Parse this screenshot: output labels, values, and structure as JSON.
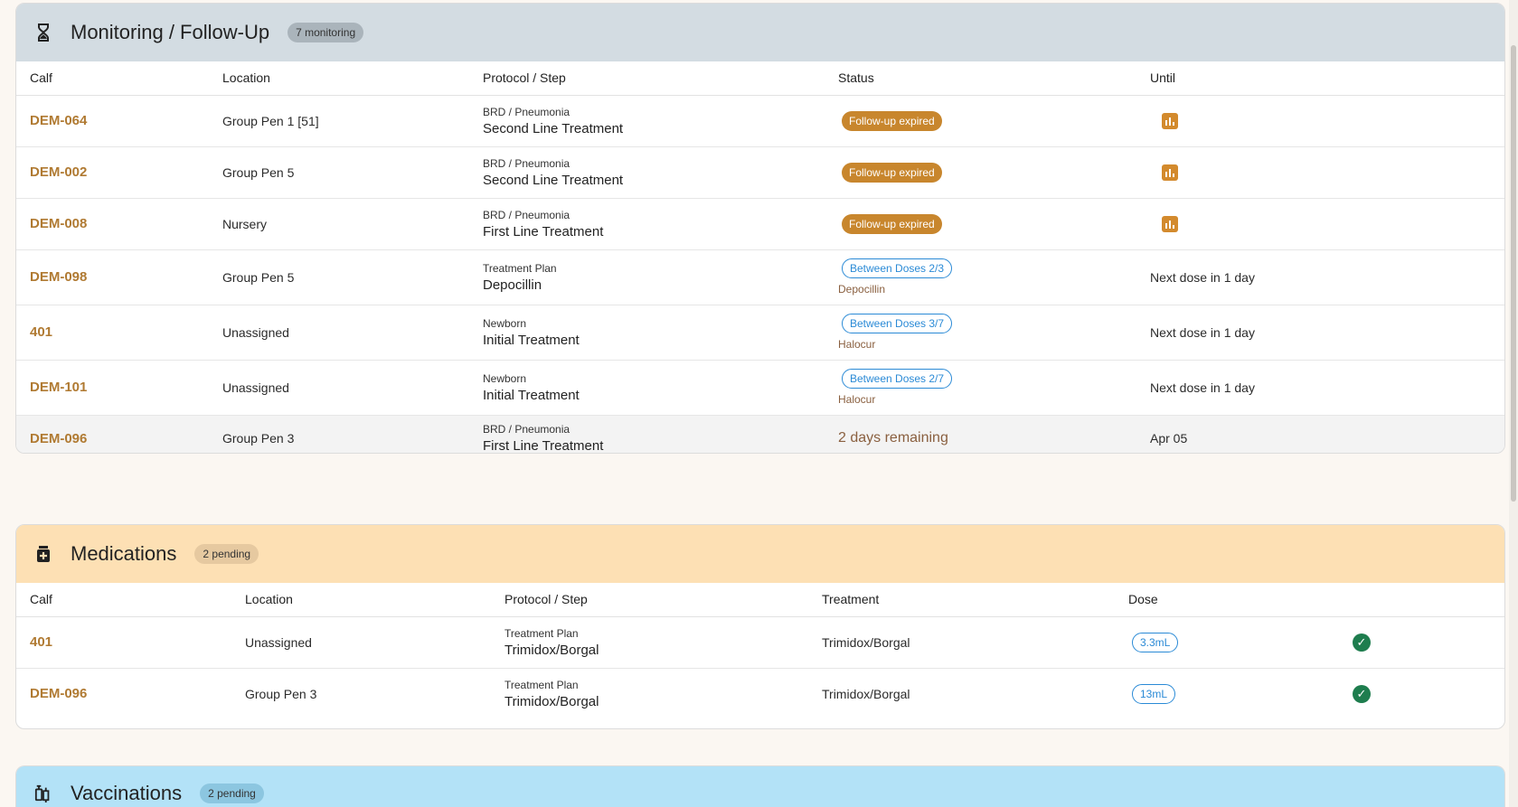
{
  "monitoring": {
    "title": "Monitoring / Follow-Up",
    "badge": "7 monitoring",
    "header_color": "#d3dce2",
    "columns": [
      "Calf",
      "Location",
      "Protocol / Step",
      "Status",
      "Until"
    ],
    "rows": [
      {
        "calf": "DEM-064",
        "location": "Group Pen 1 [51]",
        "protocol": "BRD / Pneumonia",
        "step": "Second Line Treatment",
        "status": "Follow-up expired",
        "until_icon": "bar-chart-icon"
      },
      {
        "calf": "DEM-002",
        "location": "Group Pen 5",
        "protocol": "BRD / Pneumonia",
        "step": "Second Line Treatment",
        "status": "Follow-up expired",
        "until_icon": "bar-chart-icon"
      },
      {
        "calf": "DEM-008",
        "location": "Nursery",
        "protocol": "BRD / Pneumonia",
        "step": "First Line Treatment",
        "status": "Follow-up expired",
        "until_icon": "bar-chart-icon"
      },
      {
        "calf": "DEM-098",
        "location": "Group Pen 5",
        "protocol": "Treatment Plan",
        "step": "Depocillin",
        "status": "Between Doses 2/3",
        "status_sub": "Depocillin",
        "until": "Next dose in 1 day"
      },
      {
        "calf": "401",
        "location": "Unassigned",
        "protocol": "Newborn",
        "step": "Initial Treatment",
        "status": "Between Doses 3/7",
        "status_sub": "Halocur",
        "until": "Next dose in 1 day"
      },
      {
        "calf": "DEM-101",
        "location": "Unassigned",
        "protocol": "Newborn",
        "step": "Initial Treatment",
        "status": "Between Doses 2/7",
        "status_sub": "Halocur",
        "until": "Next dose in 1 day"
      },
      {
        "calf": "DEM-096",
        "location": "Group Pen 3",
        "protocol": "BRD / Pneumonia",
        "step": "First Line Treatment",
        "status": "2 days remaining",
        "until": "Apr 05"
      }
    ]
  },
  "medications": {
    "title": "Medications",
    "badge": "2 pending",
    "header_color": "#fde0b4",
    "columns": [
      "Calf",
      "Location",
      "Protocol / Step",
      "Treatment",
      "Dose"
    ],
    "rows": [
      {
        "calf": "401",
        "location": "Unassigned",
        "protocol": "Treatment Plan",
        "step": "Trimidox/Borgal",
        "treatment": "Trimidox/Borgal",
        "dose": "3.3mL"
      },
      {
        "calf": "DEM-096",
        "location": "Group Pen 3",
        "protocol": "Treatment Plan",
        "step": "Trimidox/Borgal",
        "treatment": "Trimidox/Borgal",
        "dose": "13mL"
      }
    ]
  },
  "vaccinations": {
    "title": "Vaccinations",
    "badge": "2 pending",
    "header_color": "#b3e2f7"
  },
  "colors": {
    "accent_calf": "#b07a32",
    "expired": "#c8862d",
    "between_doses": "#2a8ad6",
    "check": "#1e7d4e"
  }
}
